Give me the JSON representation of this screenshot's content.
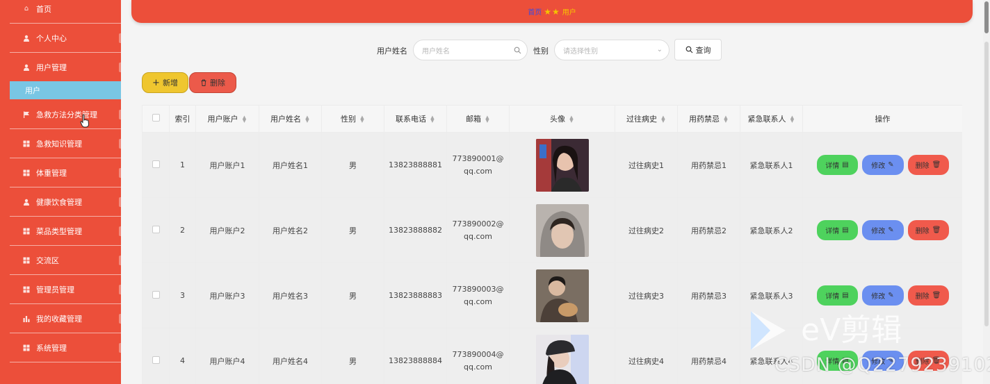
{
  "sidebar": {
    "items": [
      {
        "label": "首页",
        "icon": "home-icon"
      },
      {
        "label": "个人中心",
        "icon": "user-icon"
      },
      {
        "label": "用户管理",
        "icon": "user-icon"
      },
      {
        "label": "急救方法分类管理",
        "icon": "flag-icon"
      },
      {
        "label": "急救知识管理",
        "icon": "grid-icon"
      },
      {
        "label": "体重管理",
        "icon": "grid-icon"
      },
      {
        "label": "健康饮食管理",
        "icon": "user-icon"
      },
      {
        "label": "菜品类型管理",
        "icon": "grid-icon"
      },
      {
        "label": "交流区",
        "icon": "grid-icon"
      },
      {
        "label": "管理员管理",
        "icon": "grid-icon"
      },
      {
        "label": "我的收藏管理",
        "icon": "bar-chart-icon"
      },
      {
        "label": "系统管理",
        "icon": "grid-icon"
      }
    ],
    "active_submenu": "用户"
  },
  "breadcrumb": {
    "home": "首页",
    "current": "用户"
  },
  "search": {
    "name_label": "用户姓名",
    "name_placeholder": "用户姓名",
    "gender_label": "性别",
    "gender_placeholder": "请选择性别",
    "query_label": "查询"
  },
  "actions": {
    "add_label": "新增",
    "delete_label": "删除"
  },
  "table": {
    "headers": [
      "索引",
      "用户账户",
      "用户姓名",
      "性别",
      "联系电话",
      "邮箱",
      "头像",
      "过往病史",
      "用药禁忌",
      "紧急联系人",
      "操作"
    ],
    "rows": [
      {
        "index": "1",
        "account": "用户账户1",
        "name": "用户姓名1",
        "gender": "男",
        "phone": "13823888881",
        "email_1": "773890001@",
        "email_2": "qq.com",
        "history": "过往病史1",
        "taboo": "用药禁忌1",
        "contact": "紧急联系人1"
      },
      {
        "index": "2",
        "account": "用户账户2",
        "name": "用户姓名2",
        "gender": "男",
        "phone": "13823888882",
        "email_1": "773890002@",
        "email_2": "qq.com",
        "history": "过往病史2",
        "taboo": "用药禁忌2",
        "contact": "紧急联系人2"
      },
      {
        "index": "3",
        "account": "用户账户3",
        "name": "用户姓名3",
        "gender": "男",
        "phone": "13823888883",
        "email_1": "773890003@",
        "email_2": "qq.com",
        "history": "过往病史3",
        "taboo": "用药禁忌3",
        "contact": "紧急联系人3"
      },
      {
        "index": "4",
        "account": "用户账户4",
        "name": "用户姓名4",
        "gender": "男",
        "phone": "13823888884",
        "email_1": "773890004@",
        "email_2": "qq.com",
        "history": "过往病史4",
        "taboo": "用药禁忌4",
        "contact": "紧急联系人4"
      }
    ],
    "row_actions": {
      "detail": "详情",
      "edit": "修改",
      "delete": "删除"
    }
  },
  "watermark": "CSDN @Q2279239102",
  "colors": {
    "sidebar": "#ec4f3a",
    "submenu_active": "#79c6e4",
    "add": "#efc62f",
    "delete": "#ec5a4a",
    "detail": "#4ed25d",
    "edit": "#6b8ff0"
  }
}
